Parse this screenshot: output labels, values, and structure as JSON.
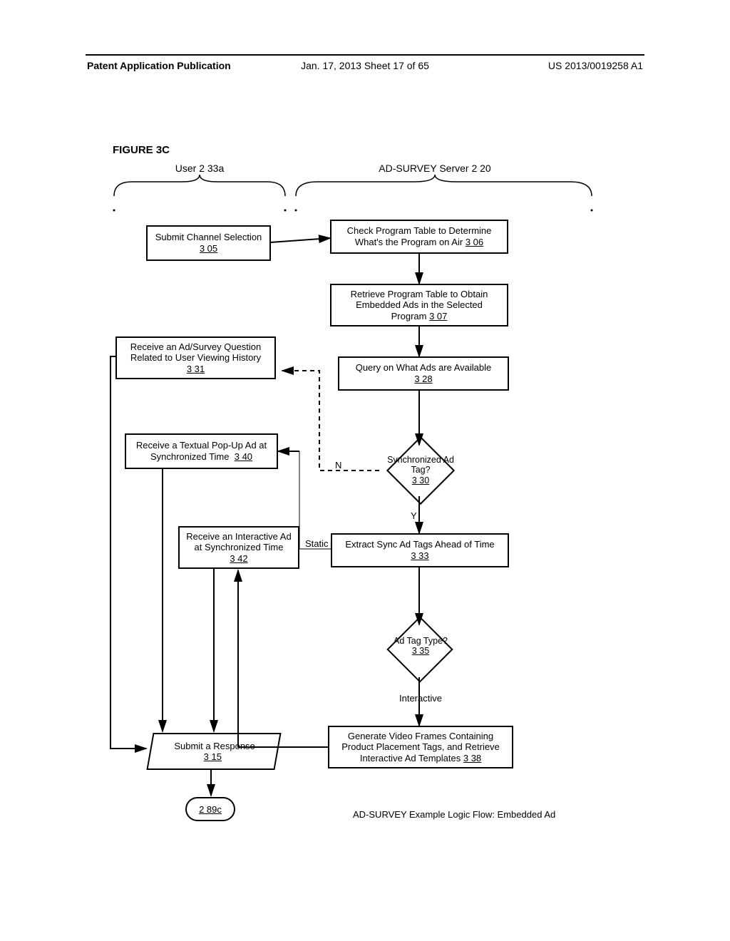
{
  "header": {
    "left": "Patent Application Publication",
    "center": "Jan. 17, 2013  Sheet 17 of 65",
    "right": "US 2013/0019258 A1"
  },
  "figure_title": "FIGURE 3C",
  "lanes": {
    "user": "User 2 33a",
    "server": "AD-SURVEY Server 2 20"
  },
  "nodes": {
    "n305": {
      "text": "Submit Channel Selection",
      "ref": "3 05"
    },
    "n306": {
      "text": "Check Program Table to Determine What's the Program on Air",
      "ref": "3 06"
    },
    "n307": {
      "text": "Retrieve Program Table to Obtain Embedded Ads in the Selected Program",
      "ref": "3 07"
    },
    "n328": {
      "text": "Query on What Ads are Available",
      "ref": "3 28"
    },
    "n331": {
      "text": "Receive an Ad/Survey Question Related to User Viewing History",
      "ref": "3 31"
    },
    "n340": {
      "text": "Receive a Textual Pop-Up Ad at Synchronized Time",
      "ref": "3 40"
    },
    "n342": {
      "text": "Receive an Interactive Ad at Synchronized Time",
      "ref": "3 42"
    },
    "n333": {
      "text": "Extract Sync Ad Tags Ahead of Time",
      "ref": "3 33"
    },
    "n338": {
      "text": "Generate Video Frames Containing Product Placement Tags, and Retrieve Interactive Ad Templates",
      "ref": "3 38"
    },
    "n315": {
      "text": "Submit a Response",
      "ref": "3 15"
    },
    "d330": {
      "text": "Synchronized Ad Tag?",
      "ref": "3 30"
    },
    "d335": {
      "text": "Ad Tag Type?",
      "ref": "3 35"
    },
    "c289c": {
      "ref": "2 89c"
    }
  },
  "edge_labels": {
    "n_330": "N",
    "y_330": "Y",
    "static": "Static",
    "interact": "Interactive"
  },
  "footer": "AD-SURVEY Example Logic Flow: Embedded Ad"
}
